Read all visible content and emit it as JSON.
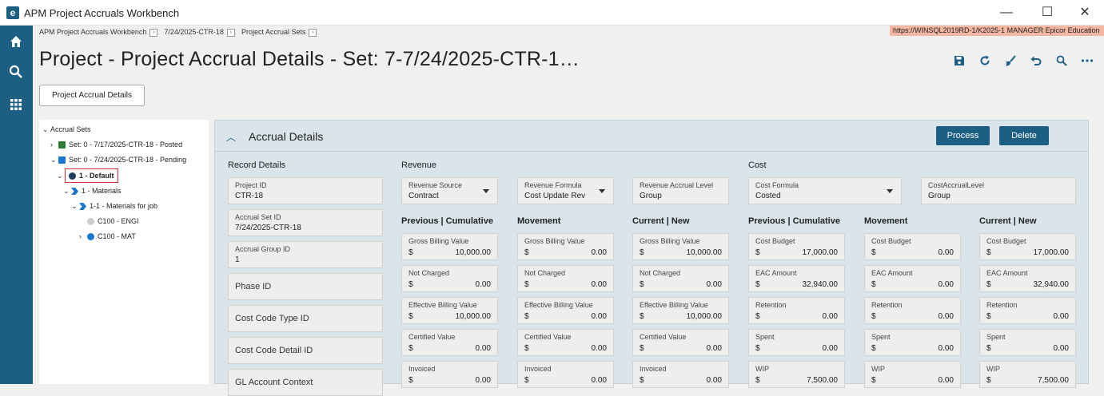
{
  "window": {
    "title": "APM Project Accruals Workbench",
    "logo": "e",
    "minimize": "—",
    "maximize": "☐",
    "close": "✕"
  },
  "breadcrumb": [
    "APM Project Accruals Workbench",
    "7/24/2025-CTR-18",
    "Project Accrual Sets"
  ],
  "env": {
    "text": "https://WINSQL2019RD-1/K2025-1   MANAGER   Epicor Education"
  },
  "page": {
    "title": "Project - Project Accrual Details - Set: 7-7/24/2025-CTR-1…"
  },
  "toolbar_icons": [
    "save-icon",
    "refresh-icon",
    "clear-icon",
    "undo-icon",
    "search-icon",
    "more-icon"
  ],
  "details_button": "Project Accrual Details",
  "tree": {
    "root": "Accrual Sets",
    "set1": "Set: 0 - 7/17/2025-CTR-18 - Posted",
    "set2": "Set: 0 - 7/24/2025-CTR-18 - Pending",
    "default": "1 - Default",
    "materials": "1 - Materials",
    "materials_job": "1-1 - Materials for job",
    "engi": "C100 - ENGI",
    "mat": "C100 - MAT"
  },
  "panel": {
    "title": "Accrual Details",
    "process": "Process",
    "delete": "Delete"
  },
  "sections": {
    "record": "Record Details",
    "revenue": "Revenue",
    "cost": "Cost",
    "prev": "Previous | Cumulative",
    "movement": "Movement",
    "current": "Current | New"
  },
  "record": {
    "project_id_label": "Project ID",
    "project_id": "CTR-18",
    "set_id_label": "Accrual Set ID",
    "set_id": "7/24/2025-CTR-18",
    "group_id_label": "Accrual Group ID",
    "group_id": "1",
    "phase_id": "Phase ID",
    "cost_code_type": "Cost Code Type ID",
    "cost_code_detail": "Cost Code Detail ID",
    "gl_context": "GL Account Context"
  },
  "revenue": {
    "source_label": "Revenue Source",
    "source": "Contract",
    "formula_label": "Revenue Formula",
    "formula": "Cost Update Rev",
    "level_label": "Revenue Accrual Level",
    "level": "Group"
  },
  "cost": {
    "formula_label": "Cost Formula",
    "formula": "Costed",
    "level_label": "CostAccrualLevel",
    "level": "Group"
  },
  "currency": "$",
  "revenue_grid": {
    "labels": [
      "Gross Billing Value",
      "Not Charged",
      "Effective Billing Value",
      "Certified Value",
      "Invoiced"
    ],
    "prev": [
      "10,000.00",
      "0.00",
      "10,000.00",
      "0.00",
      "0.00"
    ],
    "movement": [
      "0.00",
      "0.00",
      "0.00",
      "0.00",
      "0.00"
    ],
    "current": [
      "10,000.00",
      "0.00",
      "10,000.00",
      "0.00",
      "0.00"
    ]
  },
  "cost_grid": {
    "labels": [
      "Cost Budget",
      "EAC Amount",
      "Retention",
      "Spent",
      "WIP"
    ],
    "prev": [
      "17,000.00",
      "32,940.00",
      "0.00",
      "0.00",
      "7,500.00"
    ],
    "movement": [
      "0.00",
      "0.00",
      "0.00",
      "0.00",
      "0.00"
    ],
    "current": [
      "17,000.00",
      "32,940.00",
      "0.00",
      "0.00",
      "7,500.00"
    ]
  }
}
